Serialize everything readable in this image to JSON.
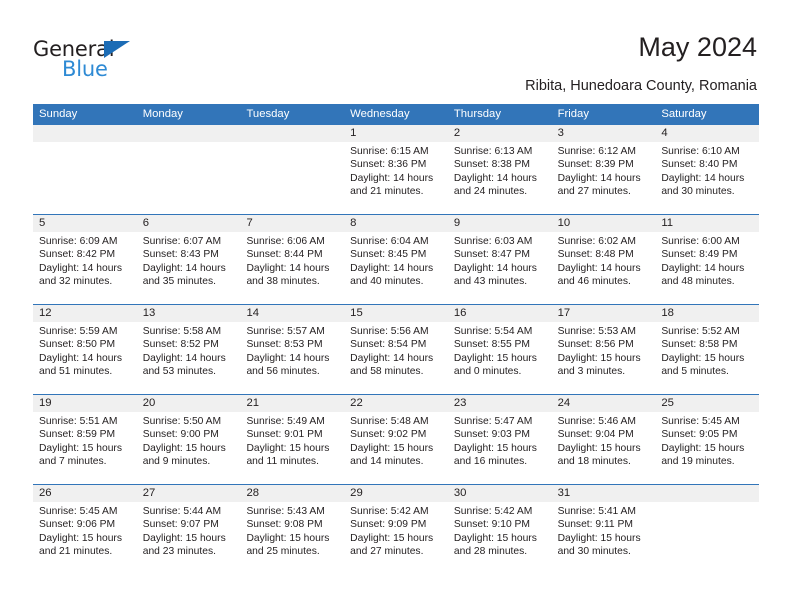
{
  "brand": {
    "name_top": "General",
    "name_bottom": "Blue",
    "triangle_color": "#1c6cb5",
    "blue_text_color": "#2e8ad4"
  },
  "header": {
    "title": "May 2024",
    "location": "Ribita, Hunedoara County, Romania"
  },
  "theme": {
    "header_blue": "#3275b9",
    "day_band_gray": "#f0f0f0",
    "text_color": "#231f20"
  },
  "weekday_headers": [
    "Sunday",
    "Monday",
    "Tuesday",
    "Wednesday",
    "Thursday",
    "Friday",
    "Saturday"
  ],
  "weeks": [
    [
      {
        "day": "",
        "sunrise": "",
        "sunset": "",
        "daylight_line1": "",
        "daylight_line2": ""
      },
      {
        "day": "",
        "sunrise": "",
        "sunset": "",
        "daylight_line1": "",
        "daylight_line2": ""
      },
      {
        "day": "",
        "sunrise": "",
        "sunset": "",
        "daylight_line1": "",
        "daylight_line2": ""
      },
      {
        "day": "1",
        "sunrise": "Sunrise: 6:15 AM",
        "sunset": "Sunset: 8:36 PM",
        "daylight_line1": "Daylight: 14 hours",
        "daylight_line2": "and 21 minutes."
      },
      {
        "day": "2",
        "sunrise": "Sunrise: 6:13 AM",
        "sunset": "Sunset: 8:38 PM",
        "daylight_line1": "Daylight: 14 hours",
        "daylight_line2": "and 24 minutes."
      },
      {
        "day": "3",
        "sunrise": "Sunrise: 6:12 AM",
        "sunset": "Sunset: 8:39 PM",
        "daylight_line1": "Daylight: 14 hours",
        "daylight_line2": "and 27 minutes."
      },
      {
        "day": "4",
        "sunrise": "Sunrise: 6:10 AM",
        "sunset": "Sunset: 8:40 PM",
        "daylight_line1": "Daylight: 14 hours",
        "daylight_line2": "and 30 minutes."
      }
    ],
    [
      {
        "day": "5",
        "sunrise": "Sunrise: 6:09 AM",
        "sunset": "Sunset: 8:42 PM",
        "daylight_line1": "Daylight: 14 hours",
        "daylight_line2": "and 32 minutes."
      },
      {
        "day": "6",
        "sunrise": "Sunrise: 6:07 AM",
        "sunset": "Sunset: 8:43 PM",
        "daylight_line1": "Daylight: 14 hours",
        "daylight_line2": "and 35 minutes."
      },
      {
        "day": "7",
        "sunrise": "Sunrise: 6:06 AM",
        "sunset": "Sunset: 8:44 PM",
        "daylight_line1": "Daylight: 14 hours",
        "daylight_line2": "and 38 minutes."
      },
      {
        "day": "8",
        "sunrise": "Sunrise: 6:04 AM",
        "sunset": "Sunset: 8:45 PM",
        "daylight_line1": "Daylight: 14 hours",
        "daylight_line2": "and 40 minutes."
      },
      {
        "day": "9",
        "sunrise": "Sunrise: 6:03 AM",
        "sunset": "Sunset: 8:47 PM",
        "daylight_line1": "Daylight: 14 hours",
        "daylight_line2": "and 43 minutes."
      },
      {
        "day": "10",
        "sunrise": "Sunrise: 6:02 AM",
        "sunset": "Sunset: 8:48 PM",
        "daylight_line1": "Daylight: 14 hours",
        "daylight_line2": "and 46 minutes."
      },
      {
        "day": "11",
        "sunrise": "Sunrise: 6:00 AM",
        "sunset": "Sunset: 8:49 PM",
        "daylight_line1": "Daylight: 14 hours",
        "daylight_line2": "and 48 minutes."
      }
    ],
    [
      {
        "day": "12",
        "sunrise": "Sunrise: 5:59 AM",
        "sunset": "Sunset: 8:50 PM",
        "daylight_line1": "Daylight: 14 hours",
        "daylight_line2": "and 51 minutes."
      },
      {
        "day": "13",
        "sunrise": "Sunrise: 5:58 AM",
        "sunset": "Sunset: 8:52 PM",
        "daylight_line1": "Daylight: 14 hours",
        "daylight_line2": "and 53 minutes."
      },
      {
        "day": "14",
        "sunrise": "Sunrise: 5:57 AM",
        "sunset": "Sunset: 8:53 PM",
        "daylight_line1": "Daylight: 14 hours",
        "daylight_line2": "and 56 minutes."
      },
      {
        "day": "15",
        "sunrise": "Sunrise: 5:56 AM",
        "sunset": "Sunset: 8:54 PM",
        "daylight_line1": "Daylight: 14 hours",
        "daylight_line2": "and 58 minutes."
      },
      {
        "day": "16",
        "sunrise": "Sunrise: 5:54 AM",
        "sunset": "Sunset: 8:55 PM",
        "daylight_line1": "Daylight: 15 hours",
        "daylight_line2": "and 0 minutes."
      },
      {
        "day": "17",
        "sunrise": "Sunrise: 5:53 AM",
        "sunset": "Sunset: 8:56 PM",
        "daylight_line1": "Daylight: 15 hours",
        "daylight_line2": "and 3 minutes."
      },
      {
        "day": "18",
        "sunrise": "Sunrise: 5:52 AM",
        "sunset": "Sunset: 8:58 PM",
        "daylight_line1": "Daylight: 15 hours",
        "daylight_line2": "and 5 minutes."
      }
    ],
    [
      {
        "day": "19",
        "sunrise": "Sunrise: 5:51 AM",
        "sunset": "Sunset: 8:59 PM",
        "daylight_line1": "Daylight: 15 hours",
        "daylight_line2": "and 7 minutes."
      },
      {
        "day": "20",
        "sunrise": "Sunrise: 5:50 AM",
        "sunset": "Sunset: 9:00 PM",
        "daylight_line1": "Daylight: 15 hours",
        "daylight_line2": "and 9 minutes."
      },
      {
        "day": "21",
        "sunrise": "Sunrise: 5:49 AM",
        "sunset": "Sunset: 9:01 PM",
        "daylight_line1": "Daylight: 15 hours",
        "daylight_line2": "and 11 minutes."
      },
      {
        "day": "22",
        "sunrise": "Sunrise: 5:48 AM",
        "sunset": "Sunset: 9:02 PM",
        "daylight_line1": "Daylight: 15 hours",
        "daylight_line2": "and 14 minutes."
      },
      {
        "day": "23",
        "sunrise": "Sunrise: 5:47 AM",
        "sunset": "Sunset: 9:03 PM",
        "daylight_line1": "Daylight: 15 hours",
        "daylight_line2": "and 16 minutes."
      },
      {
        "day": "24",
        "sunrise": "Sunrise: 5:46 AM",
        "sunset": "Sunset: 9:04 PM",
        "daylight_line1": "Daylight: 15 hours",
        "daylight_line2": "and 18 minutes."
      },
      {
        "day": "25",
        "sunrise": "Sunrise: 5:45 AM",
        "sunset": "Sunset: 9:05 PM",
        "daylight_line1": "Daylight: 15 hours",
        "daylight_line2": "and 19 minutes."
      }
    ],
    [
      {
        "day": "26",
        "sunrise": "Sunrise: 5:45 AM",
        "sunset": "Sunset: 9:06 PM",
        "daylight_line1": "Daylight: 15 hours",
        "daylight_line2": "and 21 minutes."
      },
      {
        "day": "27",
        "sunrise": "Sunrise: 5:44 AM",
        "sunset": "Sunset: 9:07 PM",
        "daylight_line1": "Daylight: 15 hours",
        "daylight_line2": "and 23 minutes."
      },
      {
        "day": "28",
        "sunrise": "Sunrise: 5:43 AM",
        "sunset": "Sunset: 9:08 PM",
        "daylight_line1": "Daylight: 15 hours",
        "daylight_line2": "and 25 minutes."
      },
      {
        "day": "29",
        "sunrise": "Sunrise: 5:42 AM",
        "sunset": "Sunset: 9:09 PM",
        "daylight_line1": "Daylight: 15 hours",
        "daylight_line2": "and 27 minutes."
      },
      {
        "day": "30",
        "sunrise": "Sunrise: 5:42 AM",
        "sunset": "Sunset: 9:10 PM",
        "daylight_line1": "Daylight: 15 hours",
        "daylight_line2": "and 28 minutes."
      },
      {
        "day": "31",
        "sunrise": "Sunrise: 5:41 AM",
        "sunset": "Sunset: 9:11 PM",
        "daylight_line1": "Daylight: 15 hours",
        "daylight_line2": "and 30 minutes."
      },
      {
        "day": "",
        "sunrise": "",
        "sunset": "",
        "daylight_line1": "",
        "daylight_line2": ""
      }
    ]
  ]
}
